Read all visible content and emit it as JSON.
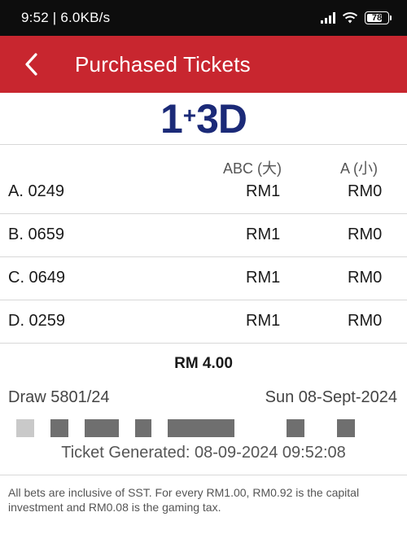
{
  "status_bar": {
    "time_speed": "9:52 | 6.0KB/s",
    "battery": "78",
    "battery_level": 0.78,
    "icons": [
      "signal-icon",
      "wifi-icon",
      "battery-icon"
    ]
  },
  "app_bar": {
    "title": "Purchased Tickets",
    "back_icon": "chevron-left-icon",
    "background": "#c8262f"
  },
  "logo": {
    "part1": "1",
    "plus": "+",
    "part2": "3D",
    "color": "#1b2a78"
  },
  "columns": {
    "big": "ABC (大)",
    "small": "A (小)"
  },
  "tickets": [
    {
      "number": "A. 0249",
      "big": "RM1",
      "small": "RM0"
    },
    {
      "number": "B. 0659",
      "big": "RM1",
      "small": "RM0"
    },
    {
      "number": "C. 0649",
      "big": "RM1",
      "small": "RM0"
    },
    {
      "number": "D. 0259",
      "big": "RM1",
      "small": "RM0"
    }
  ],
  "total": "RM 4.00",
  "draw": {
    "number": "Draw 5801/24",
    "date": "Sun 08-Sept-2024"
  },
  "generated": "Ticket Generated: 08-09-2024 09:52:08",
  "disclaimer": "All bets are inclusive of SST. For every RM1.00, RM0.92 is the capital investment and RM0.08 is the gaming tax."
}
